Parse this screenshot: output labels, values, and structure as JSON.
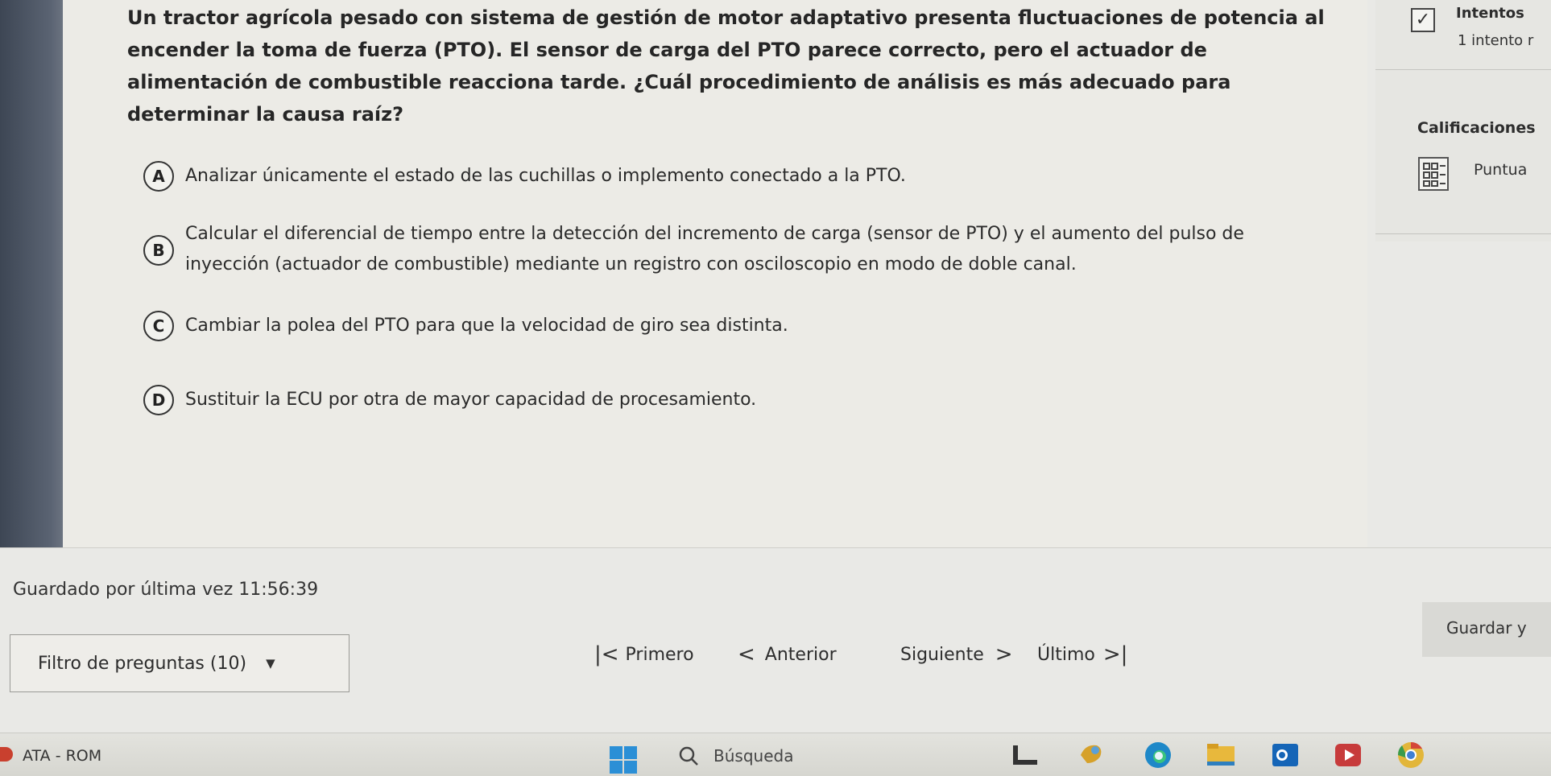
{
  "question": {
    "text": "Un tractor agrícola pesado con sistema de gestión de motor adaptativo presenta fluctuaciones de potencia al encender la toma de fuerza (PTO). El sensor de carga del PTO parece correcto, pero el actuador de alimentación de combustible reacciona tarde. ¿Cuál procedimiento de análisis es más adecuado para determinar la causa raíz?"
  },
  "options": [
    {
      "letter": "A",
      "text": "Analizar únicamente el estado de las cuchillas o implemento conectado a la PTO."
    },
    {
      "letter": "B",
      "text": "Calcular el diferencial de tiempo entre la detección del incremento de carga (sensor de PTO) y el aumento del pulso de inyección (actuador de combustible) mediante un registro con osciloscopio en modo de doble canal."
    },
    {
      "letter": "C",
      "text": "Cambiar la polea del PTO para que la velocidad de giro sea distinta."
    },
    {
      "letter": "D",
      "text": "Sustituir la ECU por otra de mayor capacidad de procesamiento."
    }
  ],
  "sidebar": {
    "attempts_title": "Intentos",
    "attempts_value": "1 intento r",
    "grades_title": "Calificaciones",
    "score_label": "Puntua"
  },
  "footer": {
    "saved_text": "Guardado por última vez 11:56:39",
    "filter_label": "Filtro de preguntas (10)",
    "save_label": "Guardar y",
    "nav": {
      "first": "Primero",
      "previous": "Anterior",
      "next": "Siguiente",
      "last": "Último"
    }
  },
  "taskbar": {
    "app_label": "ATA - ROM",
    "search_label": "Búsqueda"
  }
}
